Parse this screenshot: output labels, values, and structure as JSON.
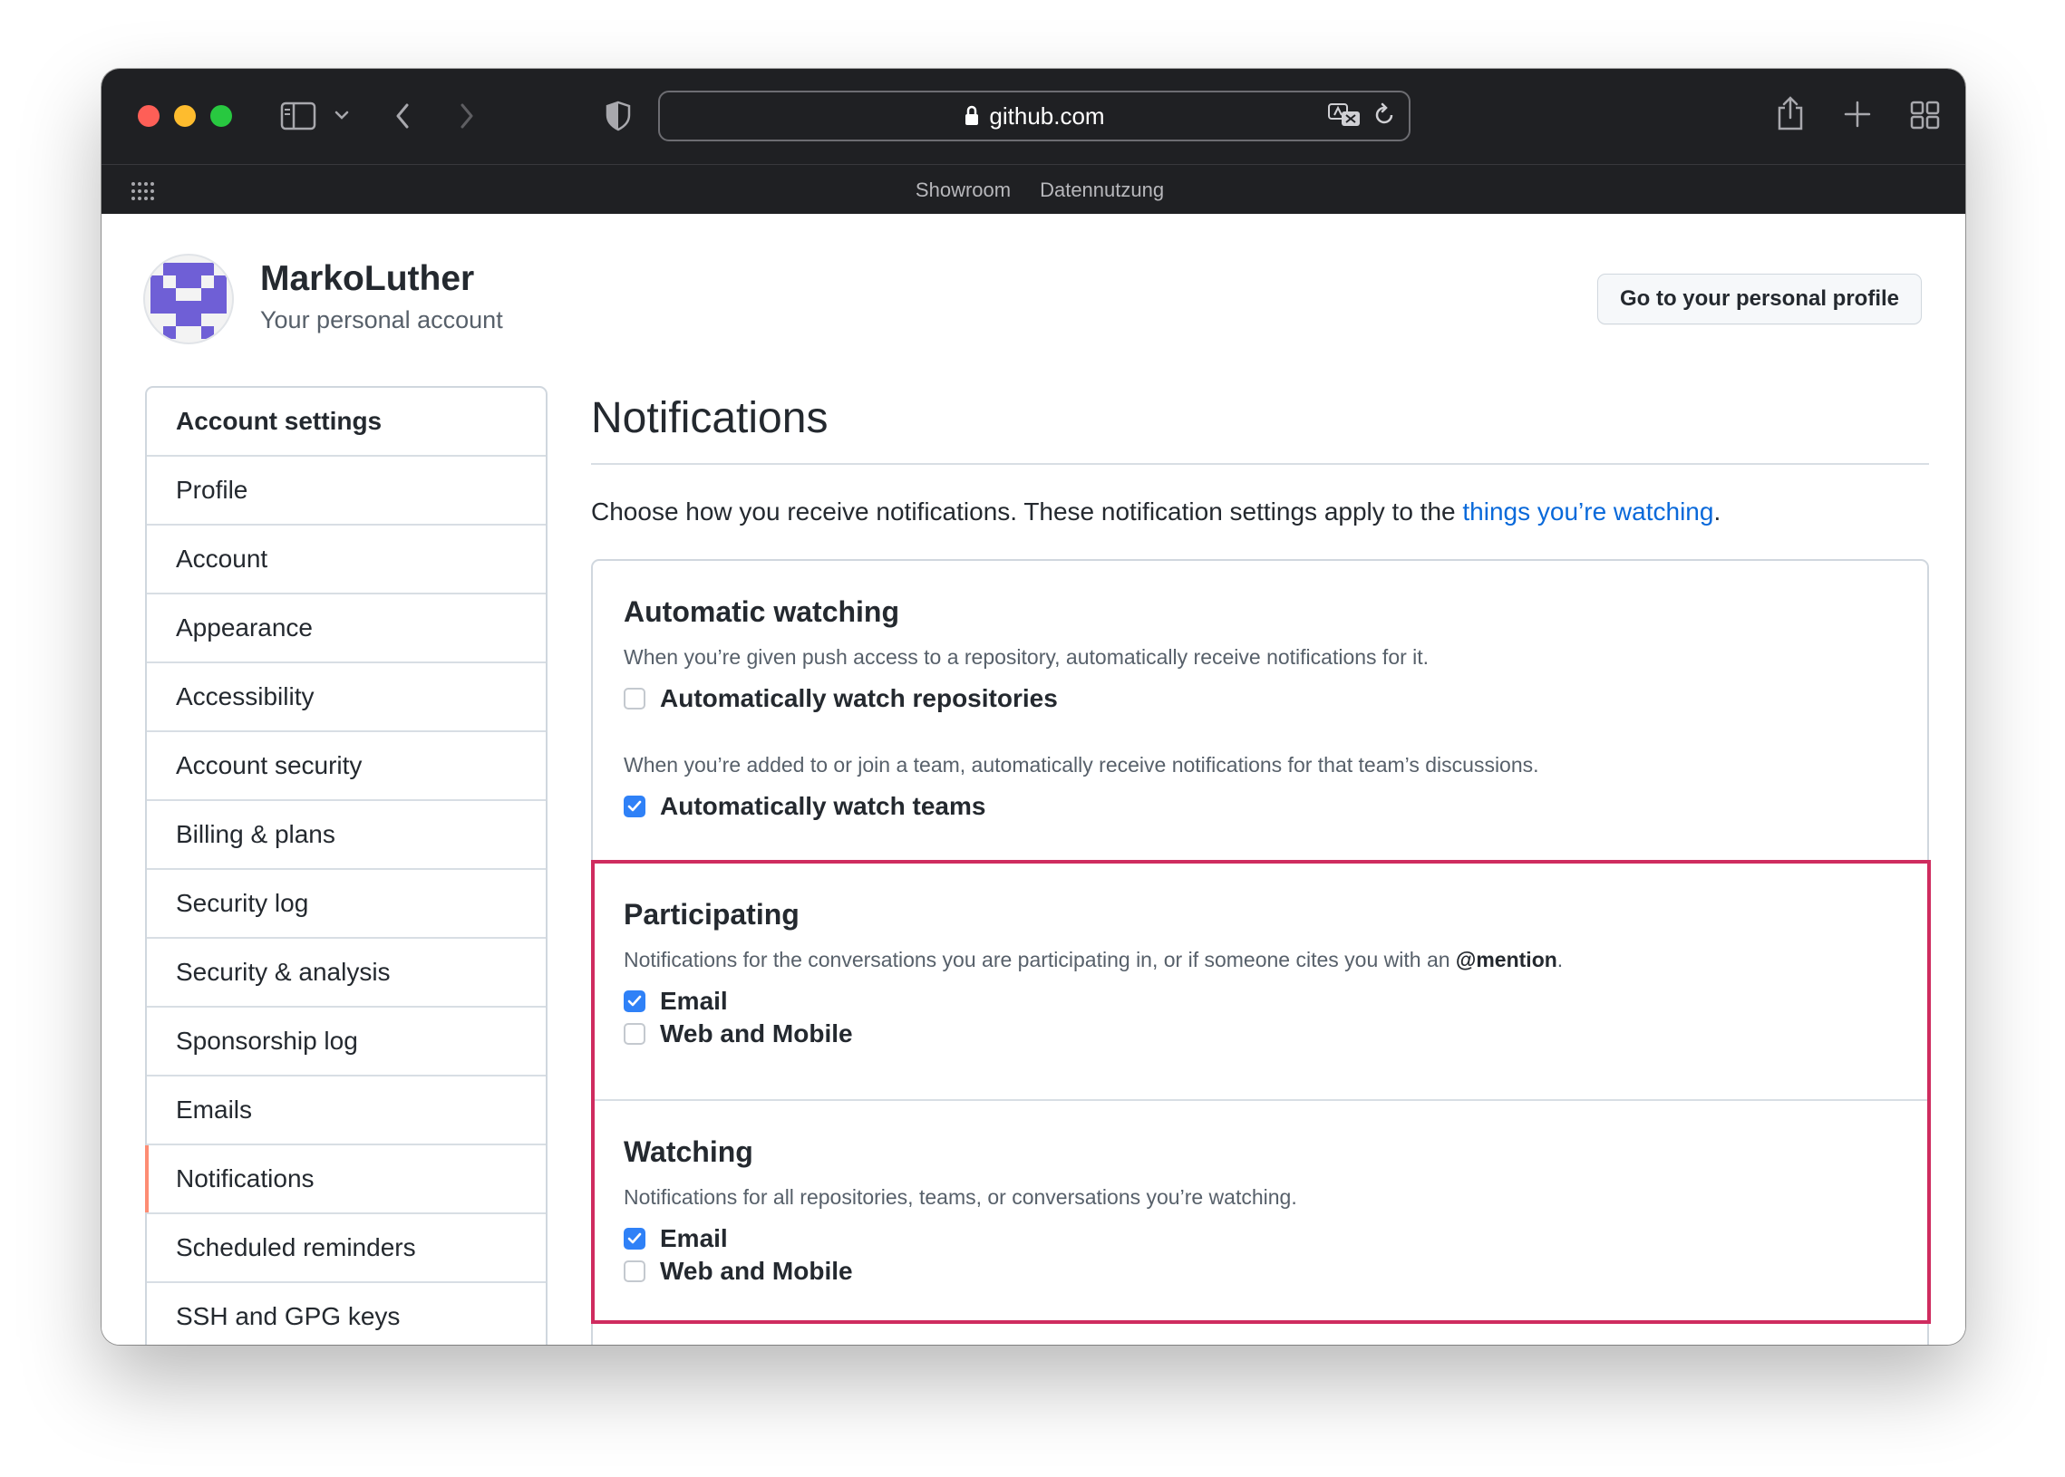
{
  "browser": {
    "url": "github.com",
    "favorites": [
      "Showroom",
      "Datennutzung"
    ]
  },
  "account": {
    "username": "MarkoLuther",
    "subtitle": "Your personal account",
    "profile_button": "Go to your personal profile"
  },
  "sidebar": {
    "header": "Account settings",
    "items": [
      {
        "label": "Profile",
        "active": false
      },
      {
        "label": "Account",
        "active": false
      },
      {
        "label": "Appearance",
        "active": false
      },
      {
        "label": "Accessibility",
        "active": false
      },
      {
        "label": "Account security",
        "active": false
      },
      {
        "label": "Billing & plans",
        "active": false
      },
      {
        "label": "Security log",
        "active": false
      },
      {
        "label": "Security & analysis",
        "active": false
      },
      {
        "label": "Sponsorship log",
        "active": false
      },
      {
        "label": "Emails",
        "active": false
      },
      {
        "label": "Notifications",
        "active": true
      },
      {
        "label": "Scheduled reminders",
        "active": false
      },
      {
        "label": "SSH and GPG keys",
        "active": false
      }
    ]
  },
  "main": {
    "title": "Notifications",
    "intro_prefix": "Choose how you receive notifications. These notification settings apply to the ",
    "intro_link": "things you’re watching",
    "intro_suffix": ".",
    "automatic": {
      "title": "Automatic watching",
      "desc_repos": "When you’re given push access to a repository, automatically receive notifications for it.",
      "watch_repos_label": "Automatically watch repositories",
      "watch_repos_checked": false,
      "desc_teams": "When you’re added to or join a team, automatically receive notifications for that team’s discussions.",
      "watch_teams_label": "Automatically watch teams",
      "watch_teams_checked": true
    },
    "participating": {
      "title": "Participating",
      "desc_prefix": "Notifications for the conversations you are participating in, or if someone cites you with an ",
      "desc_mention": "@mention",
      "desc_suffix": ".",
      "email_label": "Email",
      "email_checked": true,
      "web_label": "Web and Mobile",
      "web_checked": false
    },
    "watching": {
      "title": "Watching",
      "desc": "Notifications for all repositories, teams, or conversations you’re watching.",
      "email_label": "Email",
      "email_checked": true,
      "web_label": "Web and Mobile",
      "web_checked": false
    }
  },
  "colors": {
    "link": "#0969da",
    "checkbox_checked": "#2f81f7",
    "highlight_border": "#cf2c5f",
    "active_indicator": "#fd8c73"
  }
}
